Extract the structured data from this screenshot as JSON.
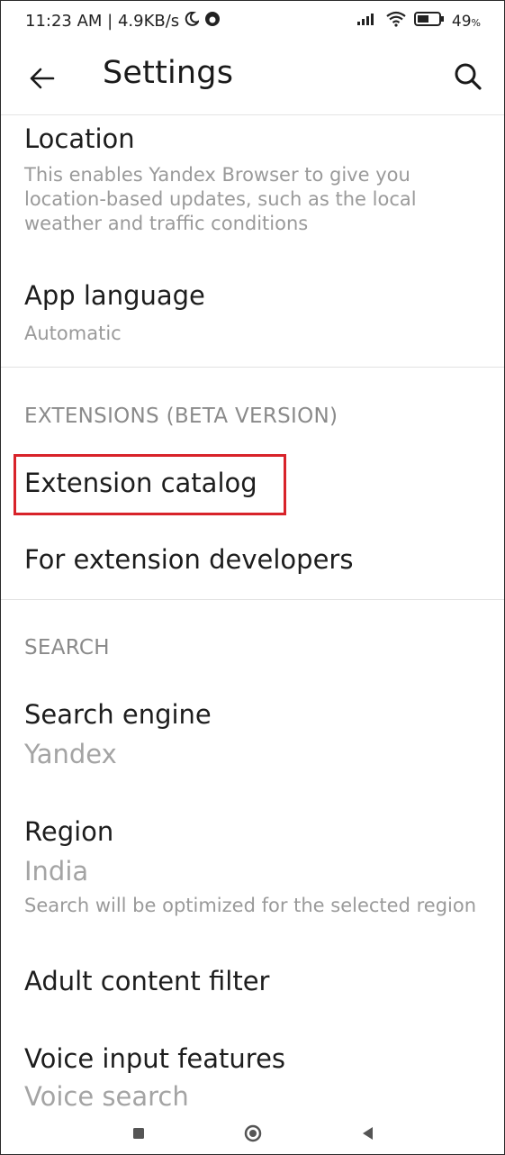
{
  "status_bar": {
    "time_speed": "11:23 AM | 4.9KB/s",
    "battery": "49"
  },
  "header": {
    "title": "Settings"
  },
  "items": {
    "location": {
      "title": "Location",
      "description": "This enables Yandex Browser to give you location-based updates, such as the local weather and traffic conditions"
    },
    "app_language": {
      "title": "App language",
      "value": "Automatic"
    },
    "extensions_header": "EXTENSIONS (BETA VERSION)",
    "extension_catalog": {
      "title": "Extension catalog"
    },
    "extension_developers": {
      "title": "For extension developers"
    },
    "search_header": "SEARCH",
    "search_engine": {
      "title": "Search engine",
      "value": "Yandex"
    },
    "region": {
      "title": "Region",
      "value": "India",
      "description": "Search will be optimized for the selected region"
    },
    "adult_filter": {
      "title": "Adult content filter"
    },
    "voice_input": {
      "title": "Voice input features",
      "value": "Voice search"
    }
  },
  "colors": {
    "highlight": "#d8232a",
    "text_primary": "#1d1d1d",
    "text_secondary": "#9a9a9a"
  }
}
